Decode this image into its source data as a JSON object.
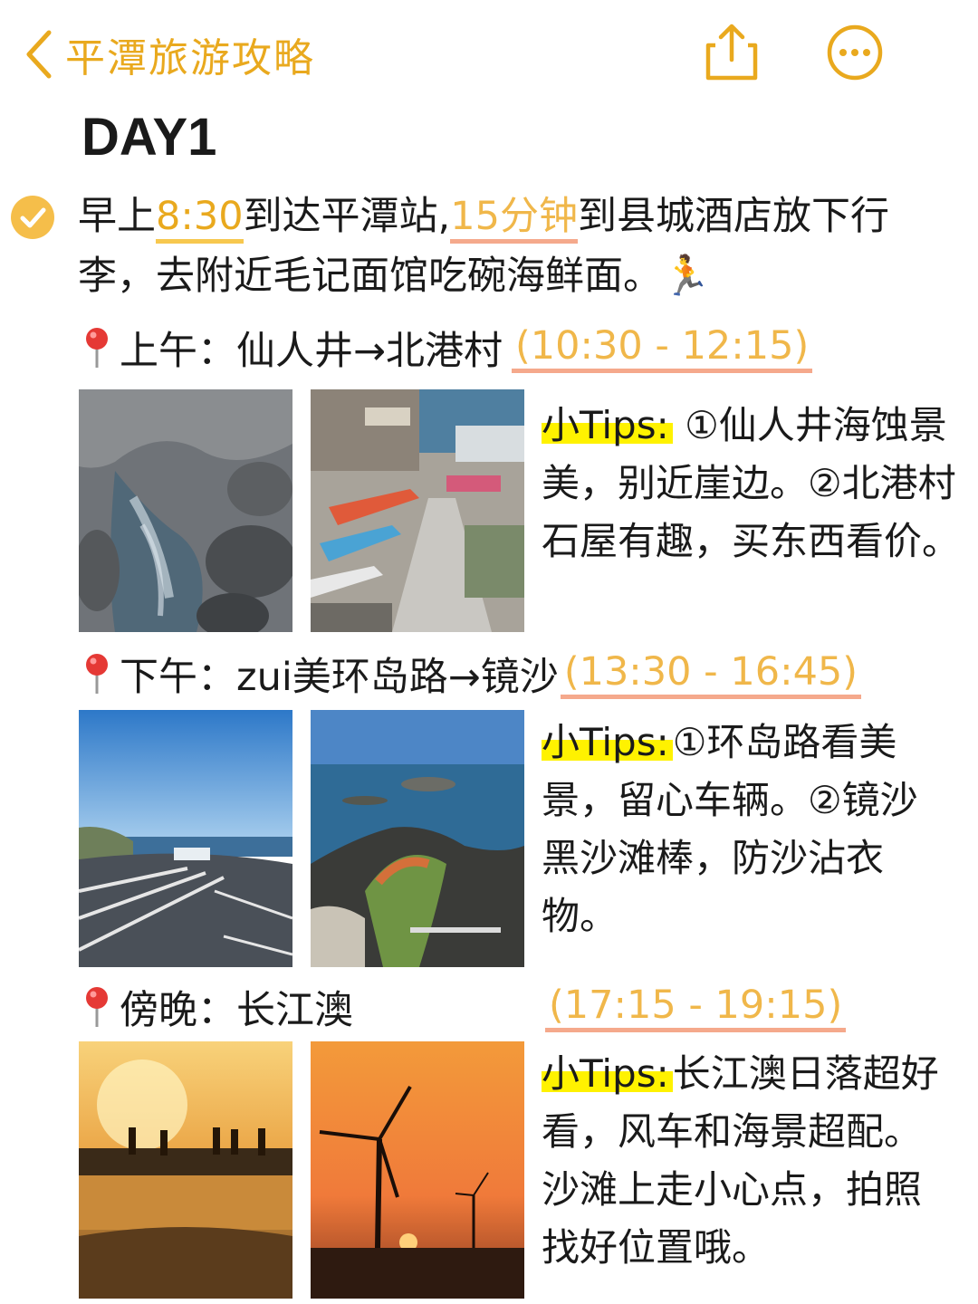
{
  "header": {
    "back_label": "平潭旅游攻略",
    "icons": [
      "chevron-left-icon",
      "share-icon",
      "more-icon"
    ],
    "accent_color": "#E9A91E"
  },
  "day_title": "DAY1",
  "intro": {
    "part1": "早上",
    "time1": "8:30",
    "part2": "到达平潭站,",
    "time2": "15分钟",
    "part3": "到县城酒店放下行李，去附近毛记面馆吃碗海鲜面。",
    "emoji": "🏃"
  },
  "sections": [
    {
      "heading": "上午：仙人井→北港村",
      "time": "(10:30 - 12:15)",
      "tips_label": "小Tips:",
      "tips_text": " ①仙人井海蚀景美，别近崖边。②北港村石屋有趣，买东西看价。"
    },
    {
      "heading": "下午：zui美环岛路→镜沙",
      "time": "(13:30 - 16:45)",
      "tips_label": "小Tips:",
      "tips_text": "①环岛路看美景，留心车辆。②镜沙黑沙滩棒，防沙沾衣物。"
    },
    {
      "heading": "傍晚：长江澳",
      "time": "(17:15 - 19:15)",
      "tips_label": "小Tips:",
      "tips_text": "长江澳日落超好看，风车和海景超配。沙滩上走小心点，拍照找好位置哦。"
    }
  ]
}
